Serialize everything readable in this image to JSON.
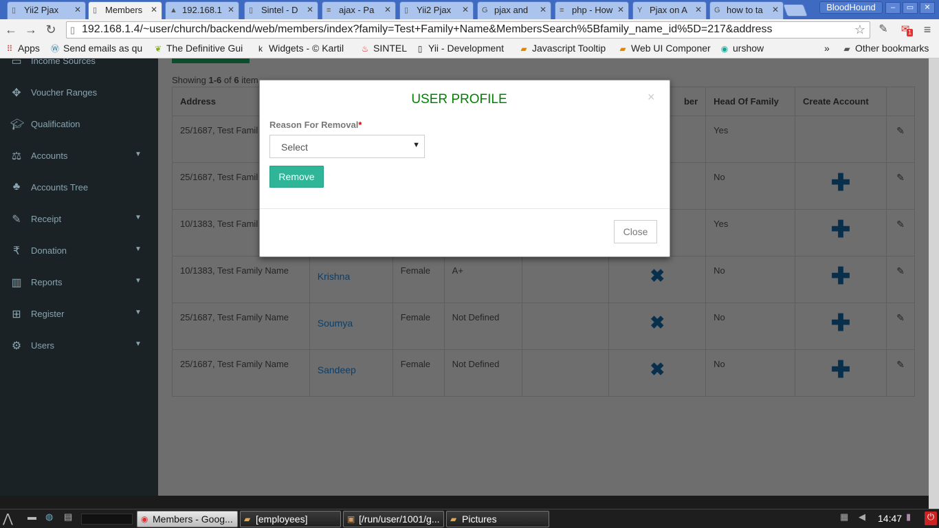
{
  "browser": {
    "tabs": [
      {
        "title": "Yii2 Pjax",
        "icon": "document-icon"
      },
      {
        "title": "Members",
        "icon": "document-icon",
        "active": true
      },
      {
        "title": "192.168.1",
        "icon": "pma-icon"
      },
      {
        "title": "Sintel - D",
        "icon": "document-icon"
      },
      {
        "title": "ajax - Pa",
        "icon": "stackoverflow-icon"
      },
      {
        "title": "Yii2 Pjax",
        "icon": "document-icon"
      },
      {
        "title": "pjax and",
        "icon": "google-icon"
      },
      {
        "title": "php - How",
        "icon": "stackoverflow-icon"
      },
      {
        "title": "Pjax on A",
        "icon": "pjax-icon"
      },
      {
        "title": "how to ta",
        "icon": "google-icon"
      }
    ],
    "profile": "BloodHound",
    "url": "192.168.1.4/~user/church/backend/web/members/index?family=Test+Family+Name&MembersSearch%5Bfamily_name_id%5D=217&address",
    "gmail_badge": "1",
    "bookmarks": [
      {
        "label": "Apps",
        "icon": "apps-icon"
      },
      {
        "label": "Send emails as qu",
        "icon": "wordpress-icon"
      },
      {
        "label": "The Definitive Gui",
        "icon": "leaf-icon"
      },
      {
        "label": "Widgets - © Kartil",
        "icon": "k-icon"
      },
      {
        "label": "SINTEL",
        "icon": "flame-icon"
      },
      {
        "label": "Yii - Development",
        "icon": "document-icon"
      },
      {
        "label": "Javascript Tooltip",
        "icon": "folder-icon"
      },
      {
        "label": "Web UI Componer",
        "icon": "folder-icon"
      },
      {
        "label": "urshow",
        "icon": "urshow-icon"
      }
    ],
    "bookmarks_overflow": "»",
    "other_bookmarks": "Other bookmarks"
  },
  "sidebar": {
    "items": [
      {
        "label": "Income Sources",
        "icon": "money-icon",
        "has_children": false
      },
      {
        "label": "Voucher Ranges",
        "icon": "arrows-icon",
        "has_children": false
      },
      {
        "label": "Qualification",
        "icon": "graduation-cap-icon",
        "has_children": false
      },
      {
        "label": "Accounts",
        "icon": "scale-icon",
        "has_children": true
      },
      {
        "label": "Accounts Tree",
        "icon": "tree-icon",
        "has_children": false
      },
      {
        "label": "Receipt",
        "icon": "edit-icon",
        "has_children": true
      },
      {
        "label": "Donation",
        "icon": "rupee-icon",
        "has_children": true
      },
      {
        "label": "Reports",
        "icon": "bar-chart-icon",
        "has_children": true
      },
      {
        "label": "Register",
        "icon": "windows-icon",
        "has_children": true
      },
      {
        "label": "Users",
        "icon": "gear-icon",
        "has_children": true
      }
    ]
  },
  "grid": {
    "summary_prefix": "Showing ",
    "summary_range": "1-6",
    "summary_mid": " of ",
    "summary_total": "6",
    "summary_suffix": " item",
    "columns": [
      "Address",
      "",
      "",
      "",
      "",
      "ber",
      "Head Of Family",
      "Create Account",
      ""
    ],
    "rows": [
      {
        "address": "25/1687, Test Famil",
        "name": "",
        "gender": "",
        "blood": "",
        "extra": "",
        "remove": false,
        "head": "Yes",
        "create": false
      },
      {
        "address": "25/1687, Test Famil",
        "name": "",
        "gender": "",
        "blood": "",
        "extra": "",
        "remove": false,
        "head": "No",
        "create": true
      },
      {
        "address": "10/1383, Test Famil",
        "name": "",
        "gender": "",
        "blood": "",
        "extra": "",
        "remove": false,
        "head": "Yes",
        "create": true
      },
      {
        "address": "10/1383, Test Family Name",
        "name": "Krishna",
        "gender": "Female",
        "blood": "A+",
        "extra": "",
        "remove": true,
        "head": "No",
        "create": true
      },
      {
        "address": "25/1687, Test Family Name",
        "name": "Soumya",
        "gender": "Female",
        "blood": "Not Defined",
        "extra": "",
        "remove": true,
        "head": "No",
        "create": true
      },
      {
        "address": "25/1687, Test Family Name",
        "name": "Sandeep",
        "gender": "Female",
        "blood": "Not Defined",
        "extra": "",
        "remove": true,
        "head": "No",
        "create": true
      }
    ]
  },
  "modal": {
    "title": "USER PROFILE",
    "close_x": "×",
    "reason_label": "Reason For Removal",
    "required_mark": "*",
    "select_value": "Select",
    "caret": "▼",
    "remove_button": "Remove",
    "close_button": "Close"
  },
  "taskbar": {
    "tasks": [
      {
        "label": "Members - Goog...",
        "icon": "chrome-icon",
        "active": true
      },
      {
        "label": "[employees]",
        "icon": "folder-icon",
        "active": false
      },
      {
        "label": "[/run/user/1001/g...",
        "icon": "image-icon",
        "active": false
      },
      {
        "label": "Pictures",
        "icon": "folder-icon",
        "active": false
      }
    ],
    "clock": "14:47"
  }
}
